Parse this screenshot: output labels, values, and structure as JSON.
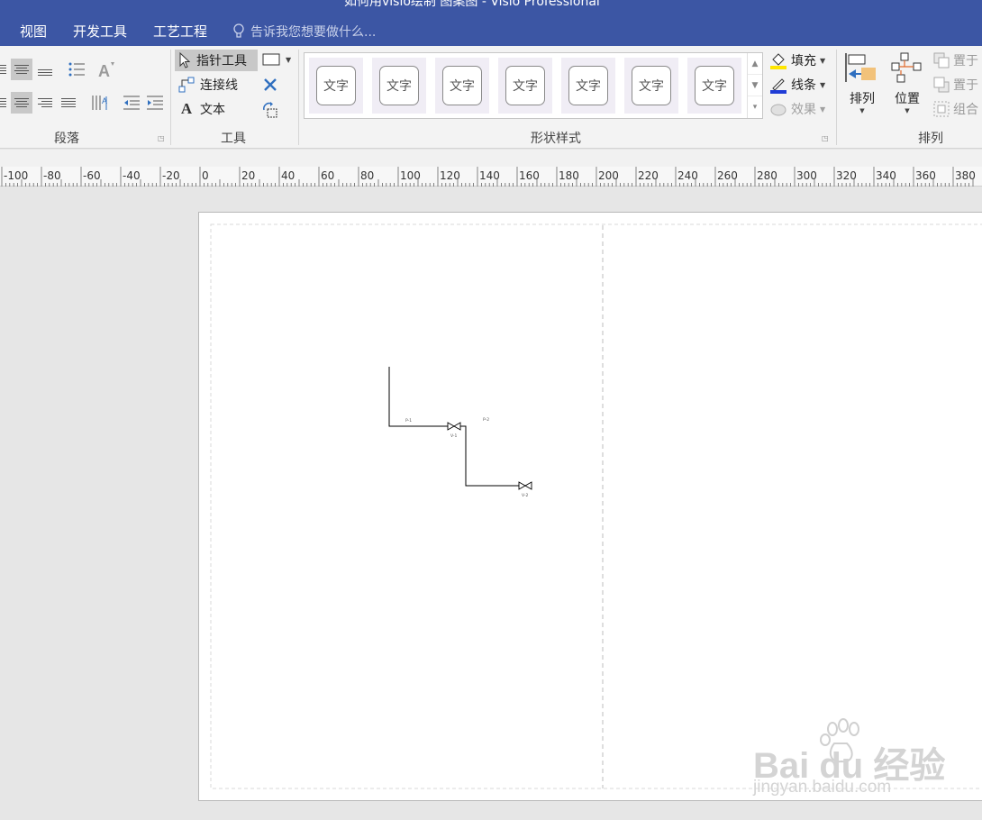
{
  "window": {
    "title": "如何用visio绘制 图案图 - Visio Professional"
  },
  "menu": {
    "tabs": [
      "视图",
      "开发工具",
      "工艺工程"
    ],
    "tell_me": "告诉我您想要做什么..."
  },
  "ribbon": {
    "paragraph": {
      "label": "段落"
    },
    "tools": {
      "label": "工具",
      "pointer": "指针工具",
      "connector": "连接线",
      "text": "文本"
    },
    "shape_styles": {
      "label": "形状样式",
      "items": [
        "文字",
        "文字",
        "文字",
        "文字",
        "文字",
        "文字",
        "文字"
      ],
      "fill": "填充",
      "line": "线条",
      "effects": "效果"
    },
    "arrange": {
      "label": "排列",
      "arrange_btn": "排列",
      "position_btn": "位置",
      "bring_front": "置于",
      "send_back": "置于",
      "group": "组合"
    }
  },
  "ruler": {
    "labels": [
      "-100",
      "-80",
      "-60",
      "-40",
      "-20",
      "0",
      "20",
      "40",
      "60",
      "80",
      "100",
      "120",
      "140",
      "160",
      "180",
      "200",
      "220",
      "240",
      "260",
      "280",
      "300",
      "320",
      "340",
      "360",
      "380"
    ]
  },
  "drawing": {
    "labels": {
      "p1": "P-1",
      "p2": "P-2",
      "v1": "V-1",
      "v2": "V-2"
    }
  },
  "watermark": {
    "brand": "Bai du 经验",
    "url": "jingyan.baidu.com"
  },
  "colors": {
    "accent": "#3c56a4",
    "fill_swatch": "#ffe600",
    "line_swatch": "#1f3cd6"
  }
}
